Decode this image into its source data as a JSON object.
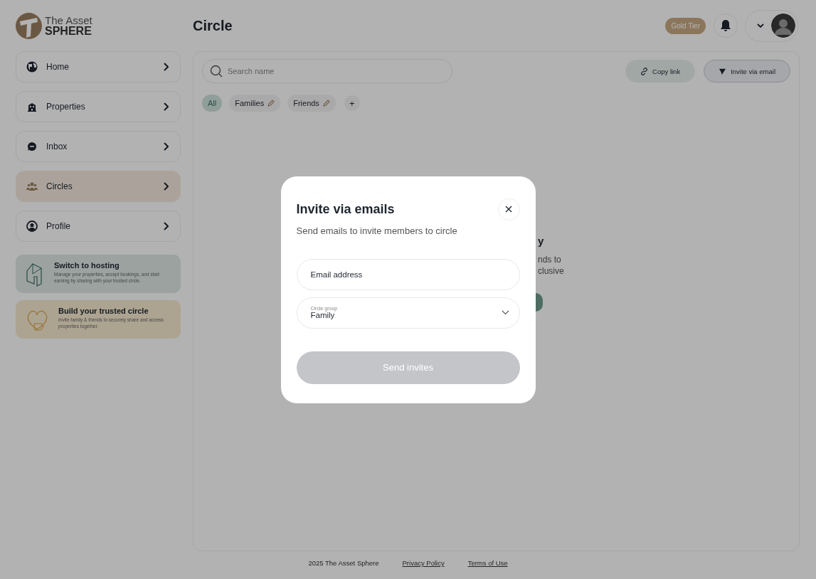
{
  "logo": {
    "line_1": "The Asset",
    "line_2": "SPHERE"
  },
  "page_title": "Circle",
  "header": {
    "tier_badge": "Gold Tier"
  },
  "sidebar": {
    "items": [
      {
        "label": "Home",
        "kind": "home",
        "selected": false
      },
      {
        "label": "Properties",
        "kind": "properties",
        "selected": false
      },
      {
        "label": "Inbox",
        "kind": "inbox",
        "selected": false
      },
      {
        "label": "Circles",
        "kind": "circles",
        "selected": true
      },
      {
        "label": "Profile",
        "kind": "profile",
        "selected": false
      }
    ],
    "promos": [
      {
        "kind": "hosting",
        "title": "Switch to hosting",
        "text": "Manage your properties, accept bookings, and start earning by sharing with your trusted circle."
      },
      {
        "kind": "circle",
        "title": "Build your trusted circle",
        "text": "Invite family & friends to securely share and access properties together."
      }
    ]
  },
  "toolbar": {
    "search": {
      "placeholder": "Search name"
    },
    "buttons": [
      {
        "kind": "copy",
        "label": "Copy link"
      },
      {
        "kind": "invite",
        "label": "Invite via email"
      }
    ]
  },
  "filters": [
    {
      "label": "All",
      "editable": false,
      "selected": true
    },
    {
      "label": "Families",
      "editable": true,
      "selected": false
    },
    {
      "label": "Friends",
      "editable": true,
      "selected": false
    }
  ],
  "add_filter": "+",
  "empty_state": {
    "title_fragment": "y",
    "text_fragments": [
      "nds to",
      "clusive"
    ]
  },
  "modal": {
    "title": "Invite via emails",
    "subtitle": "Send emails to invite members to circle",
    "email": {
      "placeholder": "Email address"
    },
    "group": {
      "label": "Circle group",
      "value": "Family"
    },
    "submit": {
      "label": "Send invites",
      "disabled": true
    }
  },
  "footer": {
    "copyright": "2025 The Asset Sphere",
    "links": [
      "Privacy Policy",
      "Terms of Use"
    ]
  }
}
